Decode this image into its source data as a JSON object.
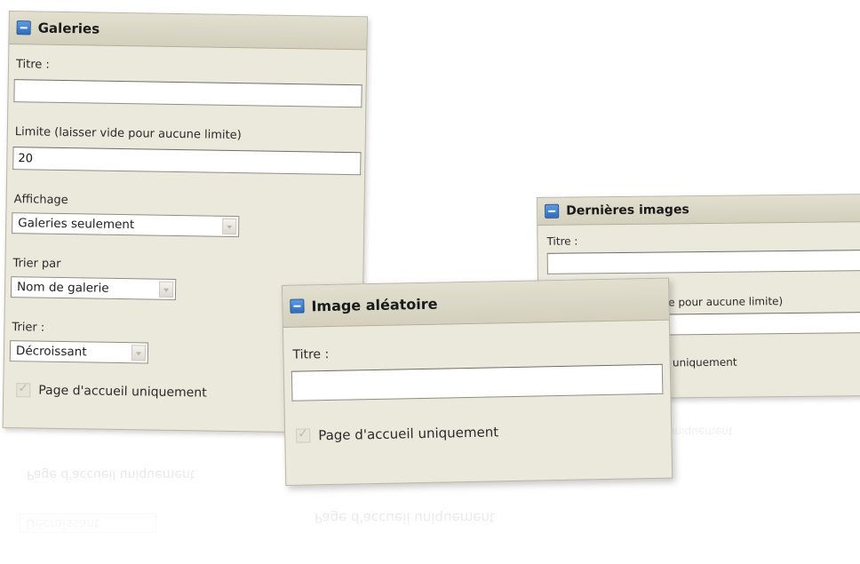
{
  "galeries": {
    "title": "Galeries",
    "titre_label": "Titre :",
    "titre_value": "",
    "limite_label": "Limite (laisser vide pour aucune limite)",
    "limite_value": "20",
    "affichage_label": "Affichage",
    "affichage_selected": "Galeries seulement",
    "trier_par_label": "Trier par",
    "trier_par_selected": "Nom de galerie",
    "trier_label": "Trier :",
    "trier_selected": "Décroissant",
    "homepage_only_label": "Page d'accueil uniquement"
  },
  "dernieres_images": {
    "title": "Dernières images",
    "titre_label": "Titre :",
    "titre_value": "",
    "limite_label_partial": "e pour aucune limite)",
    "homepage_only_label_partial": "uniquement"
  },
  "image_aleatoire": {
    "title": "Image aléatoire",
    "titre_label": "Titre :",
    "titre_value": "",
    "homepage_only_label": "Page d'accueil uniquement"
  },
  "colors": {
    "panel_bg": "#ebe8dc",
    "header_bg": "#d4d0bd",
    "accent_blue": "#2d6cc0"
  }
}
